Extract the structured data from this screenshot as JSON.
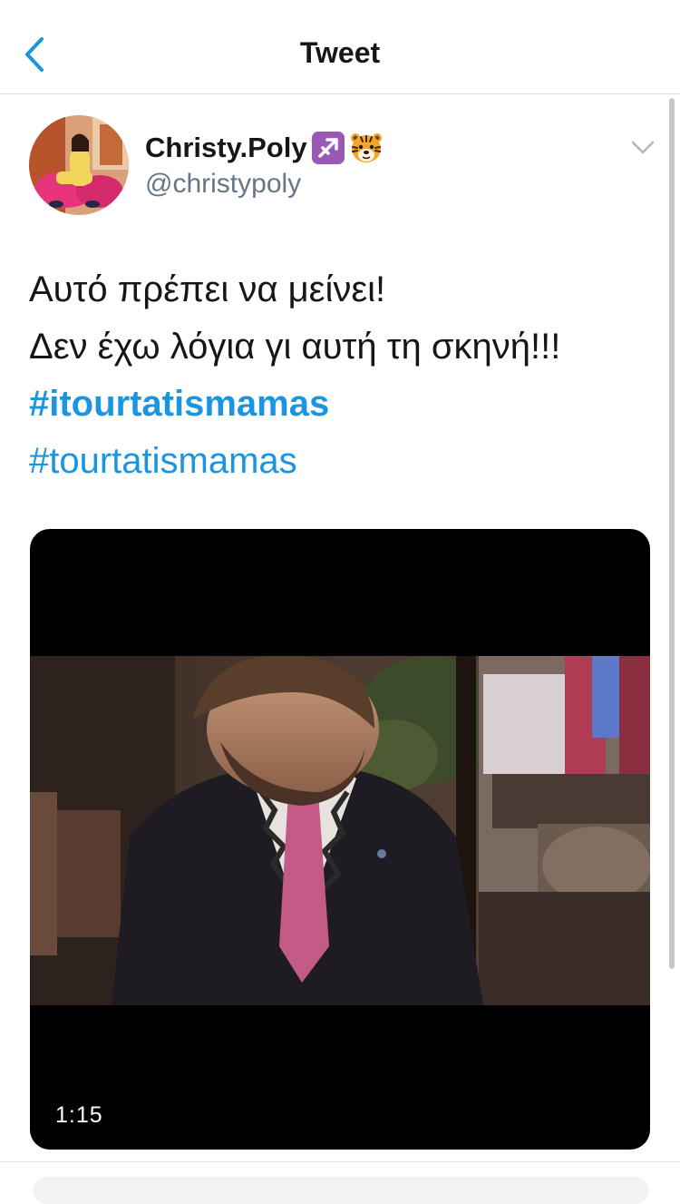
{
  "header": {
    "title": "Tweet",
    "back_icon": "chevron-left-icon"
  },
  "author": {
    "display_name": "Christy.Poly",
    "badges": [
      "sagittarius-emoji",
      "tiger-face-emoji"
    ],
    "handle": "@christypoly",
    "menu_icon": "chevron-down-icon"
  },
  "tweet": {
    "line1": "Αυτό πρέπει να μείνει!",
    "line2": "Δεν έχω λόγια γι αυτή τη σκηνή!!!",
    "hashtag1": "#itourtatismamas",
    "hashtag2": "#tourtatismamas"
  },
  "media": {
    "type": "video",
    "duration": "1:15"
  },
  "colors": {
    "accent": "#1b95e0",
    "text": "#14171a",
    "secondary": "#657786"
  }
}
